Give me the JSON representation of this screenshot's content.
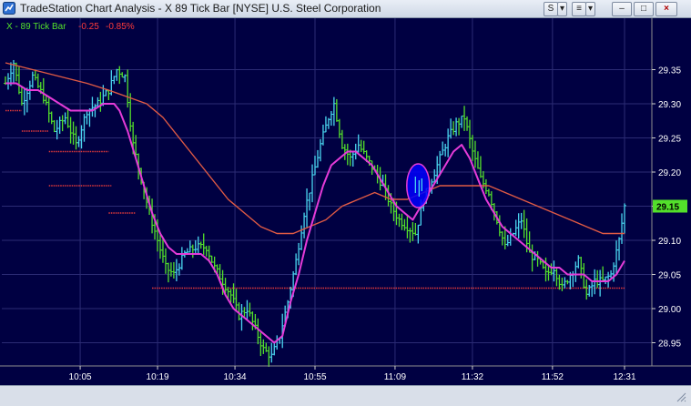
{
  "window": {
    "title": "TradeStation Chart Analysis - X 89 Tick Bar [NYSE] U.S. Steel Corporation",
    "buttons": {
      "style": "S",
      "dropdown": "▾",
      "hide": "≡",
      "minimize": "–",
      "maximize": "□",
      "close": "×"
    }
  },
  "chart_data": {
    "type": "line",
    "legend": {
      "symbol": "X - 89 Tick Bar",
      "change": "-0.25",
      "change_pct": "-0.85%"
    },
    "x_ticks": [
      "10:05",
      "10:19",
      "10:34",
      "10:55",
      "11:09",
      "11:32",
      "11:52",
      "12:31"
    ],
    "y_ticks": [
      "29.35",
      "29.30",
      "29.25",
      "29.20",
      "29.15",
      "29.10",
      "29.05",
      "29.00",
      "28.95"
    ],
    "ylim": [
      28.9,
      29.4
    ],
    "last_price": "29.15",
    "colors": {
      "background": "#000042",
      "bar_up": "#4ad6f0",
      "bar_down": "#53e02b",
      "fast_ma": "#e53bd8",
      "slow_ma": "#e05a44",
      "support": "#e0383a",
      "last_price_box": "#53e02b",
      "legend_symbol": "#53e02b",
      "legend_change": "#ff3a3a",
      "highlight_ellipse": "#0000ff"
    },
    "price_path": [
      [
        0,
        29.33
      ],
      [
        3,
        29.36
      ],
      [
        6,
        29.3
      ],
      [
        10,
        29.34
      ],
      [
        14,
        29.31
      ],
      [
        18,
        29.26
      ],
      [
        22,
        29.28
      ],
      [
        26,
        29.24
      ],
      [
        30,
        29.29
      ],
      [
        34,
        29.3
      ],
      [
        38,
        29.32
      ],
      [
        41,
        29.35
      ],
      [
        44,
        29.34
      ],
      [
        47,
        29.24
      ],
      [
        50,
        29.19
      ],
      [
        53,
        29.14
      ],
      [
        56,
        29.1
      ],
      [
        59,
        29.06
      ],
      [
        62,
        29.05
      ],
      [
        66,
        29.08
      ],
      [
        70,
        29.09
      ],
      [
        74,
        29.09
      ],
      [
        77,
        29.06
      ],
      [
        80,
        29.04
      ],
      [
        83,
        29.02
      ],
      [
        86,
        28.99
      ],
      [
        89,
        29.0
      ],
      [
        92,
        28.97
      ],
      [
        95,
        28.94
      ],
      [
        98,
        28.93
      ],
      [
        101,
        28.96
      ],
      [
        104,
        29.01
      ],
      [
        107,
        29.07
      ],
      [
        110,
        29.14
      ],
      [
        113,
        29.19
      ],
      [
        116,
        29.24
      ],
      [
        119,
        29.28
      ],
      [
        121,
        29.3
      ],
      [
        124,
        29.24
      ],
      [
        127,
        29.22
      ],
      [
        130,
        29.24
      ],
      [
        133,
        29.22
      ],
      [
        136,
        29.2
      ],
      [
        139,
        29.18
      ],
      [
        142,
        29.15
      ],
      [
        145,
        29.13
      ],
      [
        148,
        29.12
      ],
      [
        151,
        29.11
      ],
      [
        154,
        29.16
      ],
      [
        157,
        29.19
      ],
      [
        160,
        29.22
      ],
      [
        163,
        29.25
      ],
      [
        166,
        29.27
      ],
      [
        169,
        29.28
      ],
      [
        172,
        29.23
      ],
      [
        175,
        29.19
      ],
      [
        178,
        29.17
      ],
      [
        181,
        29.13
      ],
      [
        184,
        29.09
      ],
      [
        187,
        29.11
      ],
      [
        190,
        29.13
      ],
      [
        193,
        29.08
      ],
      [
        196,
        29.07
      ],
      [
        199,
        29.05
      ],
      [
        202,
        29.06
      ],
      [
        205,
        29.03
      ],
      [
        208,
        29.05
      ],
      [
        211,
        29.07
      ],
      [
        214,
        29.02
      ],
      [
        217,
        29.04
      ],
      [
        220,
        29.04
      ],
      [
        223,
        29.05
      ],
      [
        226,
        29.1
      ],
      [
        228,
        29.15
      ]
    ],
    "fast_ma_path": [
      [
        0,
        29.33
      ],
      [
        4,
        29.33
      ],
      [
        8,
        29.32
      ],
      [
        12,
        29.32
      ],
      [
        16,
        29.31
      ],
      [
        20,
        29.3
      ],
      [
        24,
        29.29
      ],
      [
        28,
        29.29
      ],
      [
        32,
        29.29
      ],
      [
        36,
        29.3
      ],
      [
        40,
        29.3
      ],
      [
        42,
        29.29
      ],
      [
        45,
        29.26
      ],
      [
        48,
        29.22
      ],
      [
        51,
        29.18
      ],
      [
        54,
        29.14
      ],
      [
        57,
        29.11
      ],
      [
        60,
        29.09
      ],
      [
        63,
        29.08
      ],
      [
        66,
        29.08
      ],
      [
        69,
        29.08
      ],
      [
        72,
        29.08
      ],
      [
        75,
        29.07
      ],
      [
        78,
        29.05
      ],
      [
        81,
        29.02
      ],
      [
        84,
        29.0
      ],
      [
        87,
        28.99
      ],
      [
        90,
        28.98
      ],
      [
        93,
        28.97
      ],
      [
        96,
        28.96
      ],
      [
        99,
        28.95
      ],
      [
        102,
        28.96
      ],
      [
        105,
        29.01
      ],
      [
        108,
        29.05
      ],
      [
        111,
        29.1
      ],
      [
        114,
        29.14
      ],
      [
        117,
        29.18
      ],
      [
        120,
        29.21
      ],
      [
        123,
        29.22
      ],
      [
        126,
        29.23
      ],
      [
        129,
        29.23
      ],
      [
        132,
        29.22
      ],
      [
        135,
        29.21
      ],
      [
        138,
        29.19
      ],
      [
        141,
        29.17
      ],
      [
        144,
        29.15
      ],
      [
        147,
        29.14
      ],
      [
        150,
        29.13
      ],
      [
        153,
        29.15
      ],
      [
        156,
        29.17
      ],
      [
        159,
        29.19
      ],
      [
        162,
        29.21
      ],
      [
        165,
        29.23
      ],
      [
        168,
        29.24
      ],
      [
        171,
        29.22
      ],
      [
        174,
        29.19
      ],
      [
        177,
        29.16
      ],
      [
        180,
        29.14
      ],
      [
        183,
        29.12
      ],
      [
        186,
        29.11
      ],
      [
        189,
        29.1
      ],
      [
        192,
        29.09
      ],
      [
        195,
        29.08
      ],
      [
        198,
        29.07
      ],
      [
        201,
        29.06
      ],
      [
        204,
        29.06
      ],
      [
        207,
        29.05
      ],
      [
        210,
        29.05
      ],
      [
        213,
        29.05
      ],
      [
        216,
        29.04
      ],
      [
        219,
        29.04
      ],
      [
        222,
        29.04
      ],
      [
        225,
        29.05
      ],
      [
        228,
        29.07
      ]
    ],
    "slow_ma_path": [
      [
        0,
        29.36
      ],
      [
        10,
        29.35
      ],
      [
        20,
        29.34
      ],
      [
        30,
        29.33
      ],
      [
        38,
        29.32
      ],
      [
        45,
        29.31
      ],
      [
        52,
        29.3
      ],
      [
        58,
        29.28
      ],
      [
        64,
        29.25
      ],
      [
        70,
        29.22
      ],
      [
        76,
        29.19
      ],
      [
        82,
        29.16
      ],
      [
        88,
        29.14
      ],
      [
        94,
        29.12
      ],
      [
        100,
        29.11
      ],
      [
        106,
        29.11
      ],
      [
        112,
        29.12
      ],
      [
        118,
        29.13
      ],
      [
        124,
        29.15
      ],
      [
        130,
        29.16
      ],
      [
        136,
        29.17
      ],
      [
        142,
        29.16
      ],
      [
        148,
        29.16
      ],
      [
        154,
        29.17
      ],
      [
        160,
        29.18
      ],
      [
        166,
        29.18
      ],
      [
        172,
        29.18
      ],
      [
        178,
        29.18
      ],
      [
        184,
        29.17
      ],
      [
        190,
        29.16
      ],
      [
        196,
        29.15
      ],
      [
        202,
        29.14
      ],
      [
        208,
        29.13
      ],
      [
        214,
        29.12
      ],
      [
        220,
        29.11
      ],
      [
        228,
        29.11
      ]
    ],
    "support_levels": [
      {
        "price": 29.29,
        "from": 0,
        "to": 6
      },
      {
        "price": 29.26,
        "from": 6,
        "to": 16
      },
      {
        "price": 29.23,
        "from": 16,
        "to": 38
      },
      {
        "price": 29.18,
        "from": 16,
        "to": 39
      },
      {
        "price": 29.14,
        "from": 38,
        "to": 48
      },
      {
        "price": 29.03,
        "from": 54,
        "to": 228
      }
    ],
    "highlight": {
      "x": 152,
      "price": 29.18,
      "rx": 4.2,
      "ry_price": 0.032
    }
  }
}
